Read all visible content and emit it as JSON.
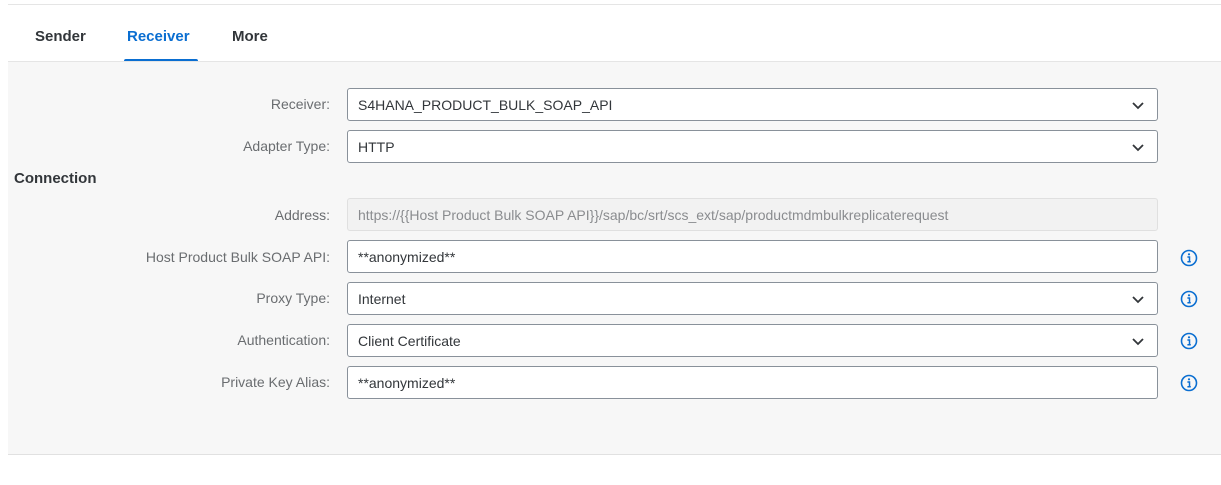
{
  "tabs": [
    {
      "label": "Sender"
    },
    {
      "label": "Receiver"
    },
    {
      "label": "More"
    }
  ],
  "section": {
    "title": "Connection"
  },
  "fields": {
    "receiver": {
      "label": "Receiver:",
      "value": "S4HANA_PRODUCT_BULK_SOAP_API"
    },
    "adapter_type": {
      "label": "Adapter Type:",
      "value": "HTTP"
    },
    "address": {
      "label": "Address:",
      "value": "https://{{Host Product Bulk SOAP API}}/sap/bc/srt/scs_ext/sap/productmdmbulkreplicaterequest"
    },
    "host": {
      "label": "Host Product Bulk SOAP API:",
      "value": "**anonymized**"
    },
    "proxy_type": {
      "label": "Proxy Type:",
      "value": "Internet"
    },
    "authentication": {
      "label": "Authentication:",
      "value": "Client Certificate"
    },
    "private_key_alias": {
      "label": "Private Key Alias:",
      "value": "**anonymized**"
    }
  },
  "icons": {
    "dropdown": "chevron-down-icon",
    "info": "info-icon"
  },
  "colors": {
    "accent": "#0a6ed1",
    "panel_bg": "#f7f7f7",
    "border": "#89919a"
  }
}
